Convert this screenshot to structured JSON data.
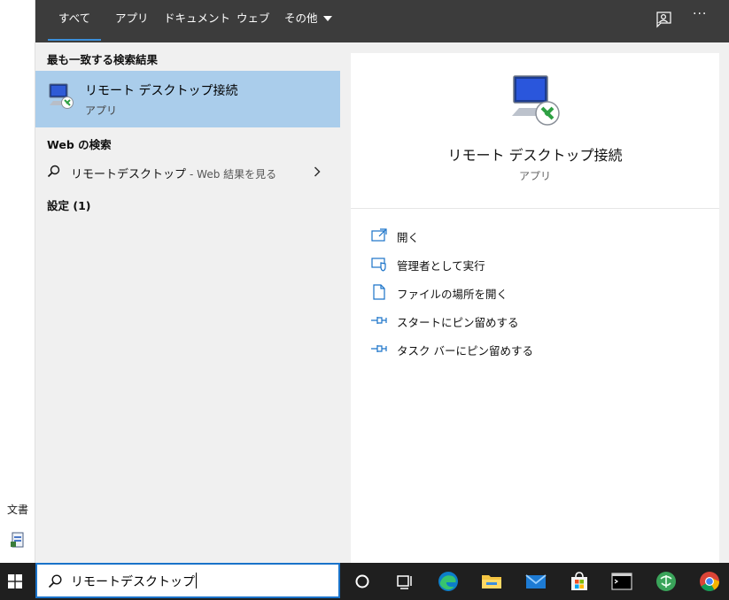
{
  "desktop": {
    "label": "文書"
  },
  "tabs": [
    {
      "label": "すべて",
      "active": true
    },
    {
      "label": "アプリ"
    },
    {
      "label": "ドキュメント"
    },
    {
      "label": "ウェブ"
    },
    {
      "label": "その他"
    }
  ],
  "topbar_icons": {
    "feedback": "feedback-icon",
    "more": "···"
  },
  "results": {
    "best_match_heading": "最も一致する検索結果",
    "best_match": {
      "title": "リモート デスクトップ接続",
      "subtitle": "アプリ",
      "icon": "remote-desktop-icon"
    },
    "web_heading": "Web の検索",
    "web_item": {
      "query": "リモートデスクトップ",
      "hint": "- Web 結果を見る"
    },
    "settings_heading": "設定 (1)"
  },
  "preview": {
    "title": "リモート デスクトップ接続",
    "subtitle": "アプリ",
    "actions": [
      {
        "label": "開く",
        "icon": "open-icon"
      },
      {
        "label": "管理者として実行",
        "icon": "admin-shield-icon"
      },
      {
        "label": "ファイルの場所を開く",
        "icon": "file-location-icon"
      },
      {
        "label": "スタートにピン留めする",
        "icon": "pin-icon"
      },
      {
        "label": "タスク バーにピン留めする",
        "icon": "pin-icon"
      }
    ]
  },
  "taskbar": {
    "search_value": "リモートデスクトップ",
    "apps": [
      "cortana",
      "task-view",
      "edge",
      "file-explorer",
      "mail",
      "store",
      "terminal",
      "app",
      "chrome"
    ]
  },
  "colors": {
    "accent": "#1a73c9",
    "selection": "#aacdeb",
    "topbar": "#3c3c3c",
    "taskbar": "#1f1f1f"
  }
}
